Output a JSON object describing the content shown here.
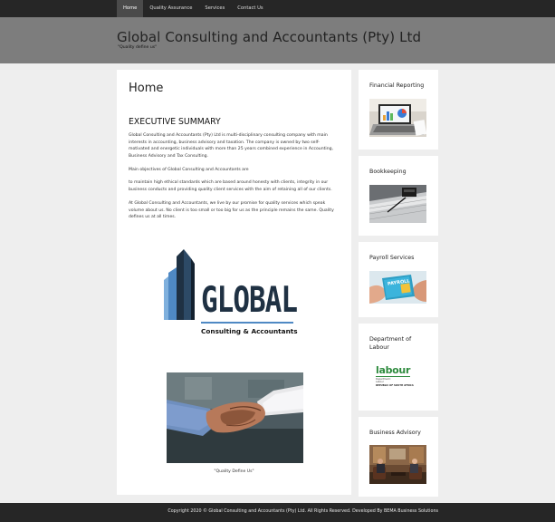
{
  "nav": {
    "items": [
      {
        "label": "Home",
        "active": true
      },
      {
        "label": "Quality Assurance",
        "active": false
      },
      {
        "label": "Services",
        "active": false
      },
      {
        "label": "Contact Us",
        "active": false
      }
    ]
  },
  "header": {
    "title": "Global Consulting and Accountants (Pty) Ltd",
    "tagline": "\"Quality define us\""
  },
  "main": {
    "title": "Home",
    "section_title": "EXECUTIVE SUMMARY",
    "paragraphs": [
      "Global Consulting and Accountants (Pty) Ltd is multi-disciplinary consulting company with main interests in accounting, business advisory and taxation. The company is owned by two self-motivated and energetic individuals with more than 25 years combined experience in Accounting, Business Advisory and Tax Consulting.",
      "Main objectives of Global Consulting and Accountants are",
      "to maintain high ethical standards which are based around honesty with clients, integrity in our business conducts and providing quality client services with the aim of retaining all of our clients.",
      "At Global Consulting and Accountants, we live by our promise for quality services which speak volume about us. No client is too small or too big for us as the principle remains the same. Quality defines us at all times."
    ],
    "logo": {
      "word": "GLOBAL",
      "subtitle": "Consulting & Accountants"
    },
    "caption": "\"Quality Define Us\""
  },
  "sidebar": {
    "cards": [
      {
        "title": "Financial Reporting"
      },
      {
        "title": "Bookkeeping"
      },
      {
        "title": "Payroll Services",
        "image_text": "PAYROLL"
      },
      {
        "title": "Department of Labour",
        "logo_word": "labour",
        "logo_lines": [
          "Department:",
          "Labour",
          "REPUBLIC OF SOUTH AFRICA"
        ]
      },
      {
        "title": "Business Advisory"
      }
    ]
  },
  "footer": {
    "text": "Copyright 2020 © Global Consulting and Accountants (Pty) Ltd. All Rights Reserved. Developed By BEMA Business Solutions"
  },
  "colors": {
    "nav_bg": "#262626",
    "header_bg": "#7d7d7d",
    "page_bg": "#eeeeee",
    "logo_navy": "#1f3143",
    "logo_blue": "#4f89c4",
    "labour_green": "#2e8b3e"
  }
}
